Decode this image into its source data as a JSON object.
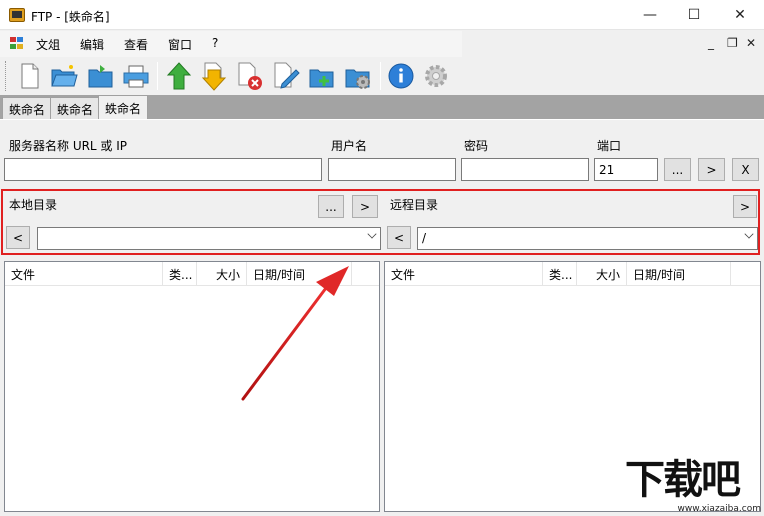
{
  "window": {
    "title": "FTP - [蛈命名]",
    "minimize": "—",
    "maximize": "☐",
    "close": "✕"
  },
  "menu": {
    "items": [
      "文俎",
      "编辑",
      "查看",
      "窗口",
      "?"
    ],
    "mdi_minimize": "_",
    "mdi_restore": "❐",
    "mdi_close": "✕"
  },
  "toolbar": {
    "icons": [
      "new-file-icon",
      "open-folder-icon",
      "save-folder-icon",
      "print-icon",
      "upload-icon",
      "download-icon",
      "delete-file-icon",
      "edit-file-icon",
      "new-folder-icon",
      "folder-settings-icon",
      "info-icon",
      "settings-gear-icon"
    ]
  },
  "tabs": [
    "蛈命名",
    "蛈命名",
    "蛈命名"
  ],
  "connection": {
    "server_label": "服务器名称 URL 或 IP",
    "server_value": "",
    "user_label": "用户名",
    "user_value": "",
    "password_label": "密码",
    "password_value": "",
    "port_label": "端口",
    "port_value": "21",
    "browse_label": "...",
    "connect_label": ">",
    "disconnect_label": "X"
  },
  "local": {
    "label": "本地目录",
    "browse_label": "...",
    "go_label": ">",
    "back_label": "<",
    "path": ""
  },
  "remote": {
    "label": "远程目录",
    "go_label": ">",
    "back_label": "<",
    "path": "/"
  },
  "local_list": {
    "columns": [
      "文件",
      "类...",
      "大小",
      "日期/时间"
    ]
  },
  "remote_list": {
    "columns": [
      "文件",
      "类...",
      "大小",
      "日期/时间"
    ]
  },
  "watermark": {
    "text": "下载吧",
    "url": "www.xiazaiba.com"
  },
  "colors": {
    "highlight": "#e02020",
    "arrow": "#d42020"
  }
}
